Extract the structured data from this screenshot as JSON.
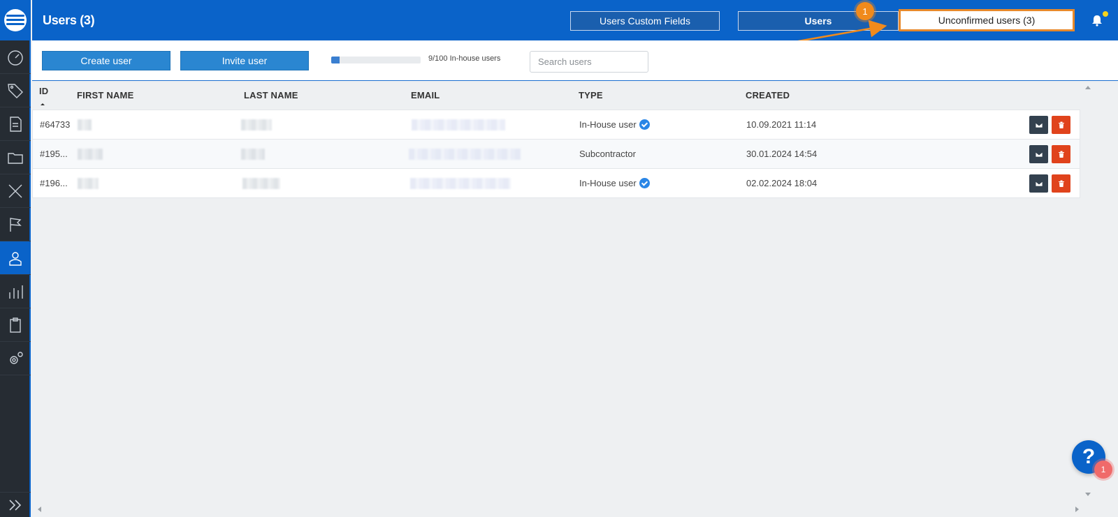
{
  "header": {
    "title": "Users (3)",
    "buttons": {
      "custom_fields": "Users Custom Fields",
      "users": "Users",
      "unconfirmed": "Unconfirmed users (3)"
    }
  },
  "annotation": {
    "step": "1",
    "color": "#f08a1c"
  },
  "toolbar": {
    "create_label": "Create user",
    "invite_label": "Invite user",
    "quota_text": "9/100 In-house users",
    "quota_fraction": 0.09,
    "search_placeholder": "Search users"
  },
  "table": {
    "columns": [
      "ID",
      "FIRST NAME",
      "LAST NAME",
      "EMAIL",
      "TYPE",
      "CREATED"
    ],
    "rows": [
      {
        "id": "#64733",
        "type": "In-House user",
        "verified": true,
        "created": "10.09.2021 11:14"
      },
      {
        "id": "#195...",
        "type": "Subcontractor",
        "verified": false,
        "created": "30.01.2024 14:54"
      },
      {
        "id": "#196...",
        "type": "In-House user",
        "verified": true,
        "created": "02.02.2024 18:04"
      }
    ]
  },
  "help": {
    "label": "?",
    "badge": "1"
  },
  "colors": {
    "primary": "#0a63c9",
    "sidebar": "#262c33",
    "delete": "#e0431c",
    "mail": "#33414f"
  }
}
